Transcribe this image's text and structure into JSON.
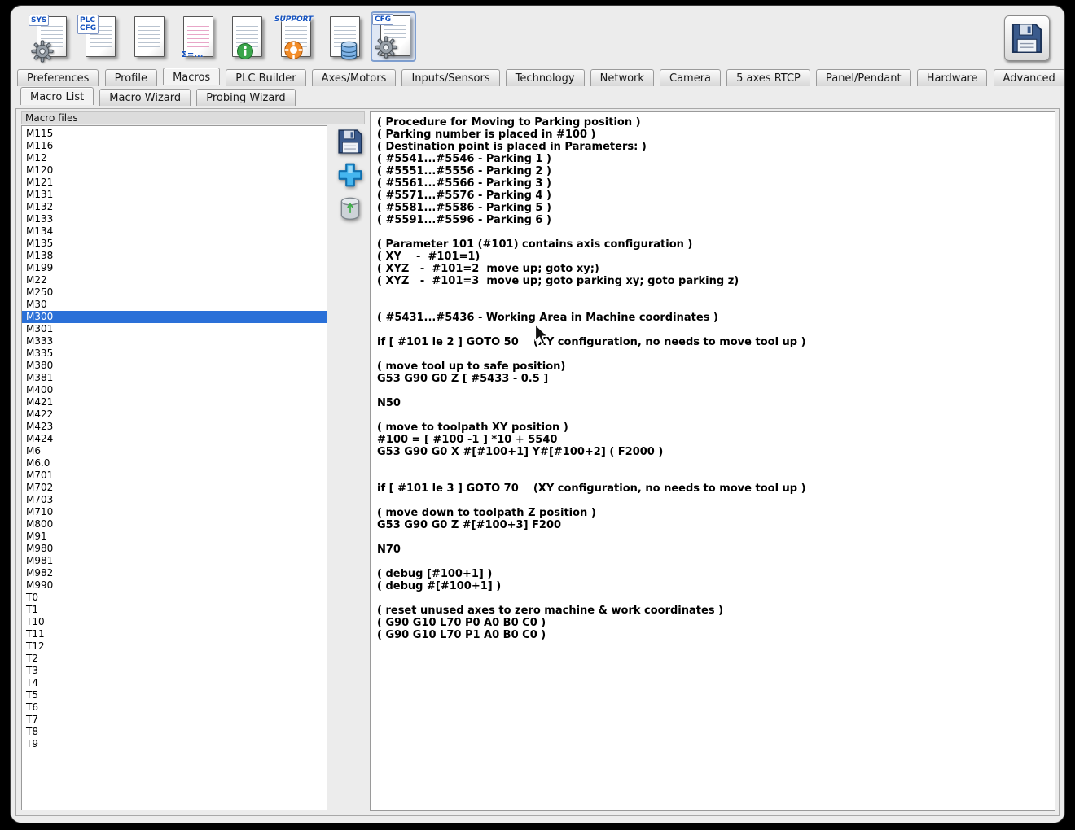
{
  "toolbar": {
    "icons": [
      {
        "name": "sys-settings",
        "label": "SYS"
      },
      {
        "name": "plc-config",
        "label": "PLC\nCFG"
      },
      {
        "name": "text-document",
        "label": ""
      },
      {
        "name": "macro-document",
        "label": "Σ=..."
      },
      {
        "name": "info-document",
        "label": ""
      },
      {
        "name": "support",
        "label": "SUPPORT"
      },
      {
        "name": "data-document",
        "label": ""
      },
      {
        "name": "cfg-settings",
        "label": "CFG"
      }
    ]
  },
  "tabs": {
    "active": "Macros",
    "items": [
      {
        "label": "Preferences"
      },
      {
        "label": "Profile"
      },
      {
        "label": "Macros"
      },
      {
        "label": "PLC Builder"
      },
      {
        "label": "Axes/Motors"
      },
      {
        "label": "Inputs/Sensors"
      },
      {
        "label": "Technology"
      },
      {
        "label": "Network"
      },
      {
        "label": "Camera"
      },
      {
        "label": "5 axes RTCP"
      },
      {
        "label": "Panel/Pendant"
      },
      {
        "label": "Hardware"
      },
      {
        "label": "Advanced"
      }
    ]
  },
  "subtabs": {
    "active": "Macro List",
    "items": [
      {
        "label": "Macro List"
      },
      {
        "label": "Macro Wizard"
      },
      {
        "label": "Probing Wizard"
      }
    ]
  },
  "macroList": {
    "header": "Macro files",
    "selected": "M300",
    "selected_color": "#2a70d8",
    "items": [
      "M115",
      "M116",
      "M12",
      "M120",
      "M121",
      "M131",
      "M132",
      "M133",
      "M134",
      "M135",
      "M138",
      "M199",
      "M22",
      "M250",
      "M30",
      "M300",
      "M301",
      "M333",
      "M335",
      "M380",
      "M381",
      "M400",
      "M421",
      "M422",
      "M423",
      "M424",
      "M6",
      "M6.0",
      "M701",
      "M702",
      "M703",
      "M710",
      "M800",
      "M91",
      "M980",
      "M981",
      "M982",
      "M990",
      "T0",
      "T1",
      "T10",
      "T11",
      "T12",
      "T2",
      "T3",
      "T4",
      "T5",
      "T6",
      "T7",
      "T8",
      "T9"
    ]
  },
  "editor": {
    "lines": [
      "( Procedure for Moving to Parking position )",
      "( Parking number is placed in #100 )",
      "( Destination point is placed in Parameters: )",
      "( #5541...#5546 - Parking 1 )",
      "( #5551...#5556 - Parking 2 )",
      "( #5561...#5566 - Parking 3 )",
      "( #5571...#5576 - Parking 4 )",
      "( #5581...#5586 - Parking 5 )",
      "( #5591...#5596 - Parking 6 )",
      "",
      "( Parameter 101 (#101) contains axis configuration )",
      "( XY    -  #101=1)",
      "( XYZ   -  #101=2  move up; goto xy;)",
      "( XYZ   -  #101=3  move up; goto parking xy; goto parking z)",
      "",
      "",
      "( #5431...#5436 - Working Area in Machine coordinates )",
      "",
      "if [ #101 le 2 ] GOTO 50    (XY configuration, no needs to move tool up )",
      "",
      "( move tool up to safe position)",
      "G53 G90 G0 Z [ #5433 - 0.5 ]",
      "",
      "N50",
      "",
      "( move to toolpath XY position )",
      "#100 = [ #100 -1 ] *10 + 5540",
      "G53 G90 G0 X #[#100+1] Y#[#100+2] ( F2000 )",
      "",
      "",
      "if [ #101 le 3 ] GOTO 70    (XY configuration, no needs to move tool up )",
      "",
      "( move down to toolpath Z position )",
      "G53 G90 G0 Z #[#100+3] F200",
      "",
      "N70",
      "",
      "( debug [#100+1] )",
      "( debug #[#100+1] )",
      "",
      "( reset unused axes to zero machine & work coordinates )",
      "( G90 G10 L70 P0 A0 B0 C0 )",
      "( G90 G10 L70 P1 A0 B0 C0 )"
    ]
  }
}
